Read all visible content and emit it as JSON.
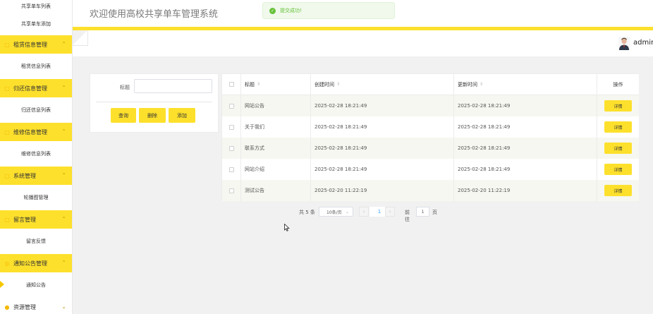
{
  "header": {
    "site_title": "欢迎使用高校共享单车管理系统"
  },
  "toast": {
    "text": "提交成功!",
    "icon": "check-circle-icon"
  },
  "user": {
    "name": "admin"
  },
  "sidebar": {
    "top_items": [
      "共享单车列表",
      "共享单车添加"
    ],
    "groups": [
      {
        "label": "租赁信息管理",
        "sub": "租赁信息列表"
      },
      {
        "label": "归还信息管理",
        "sub": "归还信息列表"
      },
      {
        "label": "维修信息管理",
        "sub": "维修信息列表"
      },
      {
        "label": "系统管理",
        "sub": "轮播图管理"
      },
      {
        "label": "留言管理",
        "sub": "留言反馈"
      },
      {
        "label": "通知公告管理",
        "sub": "通知公告"
      },
      {
        "label": "资源管理"
      }
    ]
  },
  "search": {
    "label": "标题",
    "value": "",
    "buttons": {
      "query": "查询",
      "delete": "删除",
      "add": "添加"
    }
  },
  "table": {
    "headers": {
      "title": "标题",
      "created": "创建时间",
      "updated": "更新时间",
      "actions": "操作"
    },
    "sort_icon": "⇕",
    "detail_label": "详情",
    "rows": [
      {
        "title": "网站公告",
        "created": "2025-02-28 18:21:49",
        "updated": "2025-02-28 18:21:49"
      },
      {
        "title": "关于我们",
        "created": "2025-02-28 18:21:49",
        "updated": "2025-02-28 18:21:49"
      },
      {
        "title": "联系方式",
        "created": "2025-02-28 18:21:49",
        "updated": "2025-02-28 18:21:49"
      },
      {
        "title": "网站介绍",
        "created": "2025-02-28 18:21:49",
        "updated": "2025-02-28 18:21:49"
      },
      {
        "title": "测试公告",
        "created": "2025-02-20 11:22:19",
        "updated": "2025-02-20 11:22:19"
      }
    ]
  },
  "pagination": {
    "total": "共 5 条",
    "page_size": "10条/页",
    "current_page": "1",
    "goto_label": "前往",
    "goto_value": "1",
    "page_suffix": "页"
  }
}
